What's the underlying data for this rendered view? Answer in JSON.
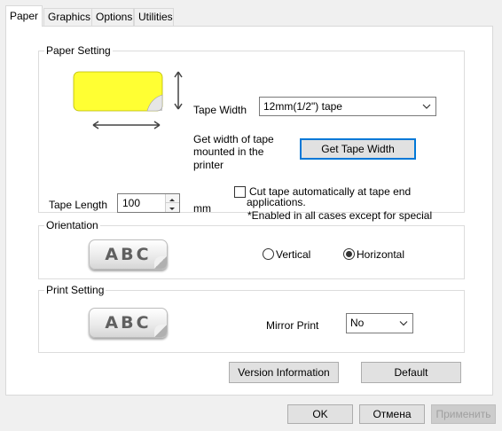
{
  "tabs": [
    {
      "label": "Paper",
      "active": true
    },
    {
      "label": "Graphics"
    },
    {
      "label": "Options"
    },
    {
      "label": "Utilities"
    }
  ],
  "paper_setting": {
    "title": "Paper Setting",
    "tape_width_label": "Tape Width",
    "tape_width_value": "12mm(1/2\") tape",
    "get_width_text_1": "Get width of tape",
    "get_width_text_2": "mounted in the",
    "get_width_text_3": "printer",
    "get_width_button": "Get Tape Width",
    "tape_length_label": "Tape Length",
    "tape_length_value": "100",
    "tape_length_unit": "mm",
    "cut_tape_label": "Cut tape automatically at tape end",
    "cut_tape_checked": false,
    "note_1": "*Enabled in all cases except for special",
    "note_2": "applications.",
    "tape_color": "#ffff33"
  },
  "orientation": {
    "title": "Orientation",
    "preview_text": "ABC",
    "vertical_label": "Vertical",
    "horizontal_label": "Horizontal",
    "selected": "Horizontal"
  },
  "print_setting": {
    "title": "Print Setting",
    "preview_text": "ABC",
    "mirror_print_label": "Mirror Print",
    "mirror_print_value": "No"
  },
  "buttons": {
    "version_info": "Version Information",
    "default": "Default",
    "ok": "OK",
    "cancel": "Отмена",
    "apply": "Применить"
  }
}
